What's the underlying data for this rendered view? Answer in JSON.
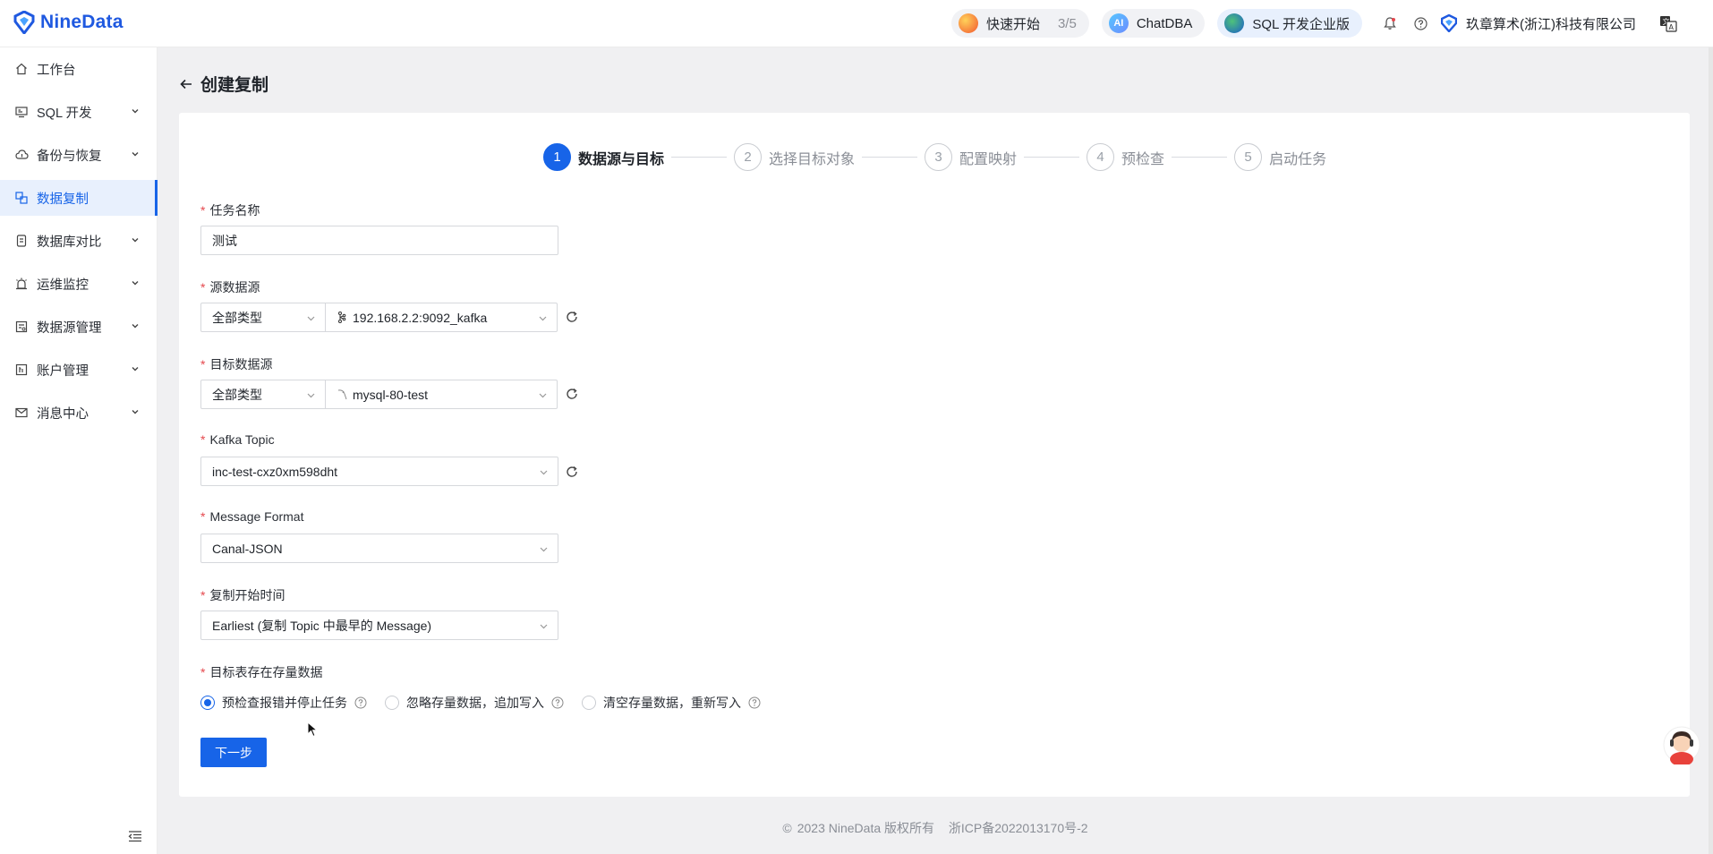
{
  "brand": {
    "name": "NineData"
  },
  "header": {
    "quick_start_label": "快速开始",
    "quick_start_progress": "3/5",
    "chatdba_label": "ChatDBA",
    "chatdba_badge": "AI",
    "edition_label": "SQL 开发企业版",
    "company_name": "玖章算术(浙江)科技有限公司"
  },
  "sidebar": {
    "items": [
      {
        "label": "工作台",
        "icon": "home-icon",
        "has_children": false,
        "active": false
      },
      {
        "label": "SQL 开发",
        "icon": "monitor-icon",
        "has_children": true,
        "active": false
      },
      {
        "label": "备份与恢复",
        "icon": "cloud-icon",
        "has_children": true,
        "active": false
      },
      {
        "label": "数据复制",
        "icon": "copy-icon",
        "has_children": false,
        "active": true
      },
      {
        "label": "数据库对比",
        "icon": "compare-icon",
        "has_children": true,
        "active": false
      },
      {
        "label": "运维监控",
        "icon": "alarm-icon",
        "has_children": true,
        "active": false
      },
      {
        "label": "数据源管理",
        "icon": "datasource-icon",
        "has_children": true,
        "active": false
      },
      {
        "label": "账户管理",
        "icon": "account-icon",
        "has_children": true,
        "active": false
      },
      {
        "label": "消息中心",
        "icon": "mail-icon",
        "has_children": true,
        "active": false
      }
    ]
  },
  "page": {
    "title": "创建复制"
  },
  "steps": [
    {
      "num": "1",
      "label": "数据源与目标",
      "active": true
    },
    {
      "num": "2",
      "label": "选择目标对象",
      "active": false
    },
    {
      "num": "3",
      "label": "配置映射",
      "active": false
    },
    {
      "num": "4",
      "label": "预检查",
      "active": false
    },
    {
      "num": "5",
      "label": "启动任务",
      "active": false
    }
  ],
  "form": {
    "task_name": {
      "label": "任务名称",
      "value": "测试"
    },
    "source": {
      "label": "源数据源",
      "type_value": "全部类型",
      "value": "192.168.2.2:9092_kafka"
    },
    "target": {
      "label": "目标数据源",
      "type_value": "全部类型",
      "value": "mysql-80-test"
    },
    "kafka_topic": {
      "label": "Kafka Topic",
      "value": "inc-test-cxz0xm598dht"
    },
    "message_format": {
      "label": "Message Format",
      "value": "Canal-JSON"
    },
    "start_time": {
      "label": "复制开始时间",
      "value": "Earliest (复制 Topic 中最早的 Message)"
    },
    "existing_data": {
      "label": "目标表存在存量数据",
      "options": [
        {
          "label": "预检查报错并停止任务",
          "checked": true
        },
        {
          "label": "忽略存量数据，追加写入",
          "checked": false
        },
        {
          "label": "清空存量数据，重新写入",
          "checked": false
        }
      ]
    },
    "next_label": "下一步"
  },
  "footer": {
    "copyright": "2023 NineData 版权所有",
    "icp": "浙ICP备2022013170号-2"
  },
  "colors": {
    "primary": "#1764e8",
    "brand": "#1f59e0",
    "required": "#e5484d"
  }
}
